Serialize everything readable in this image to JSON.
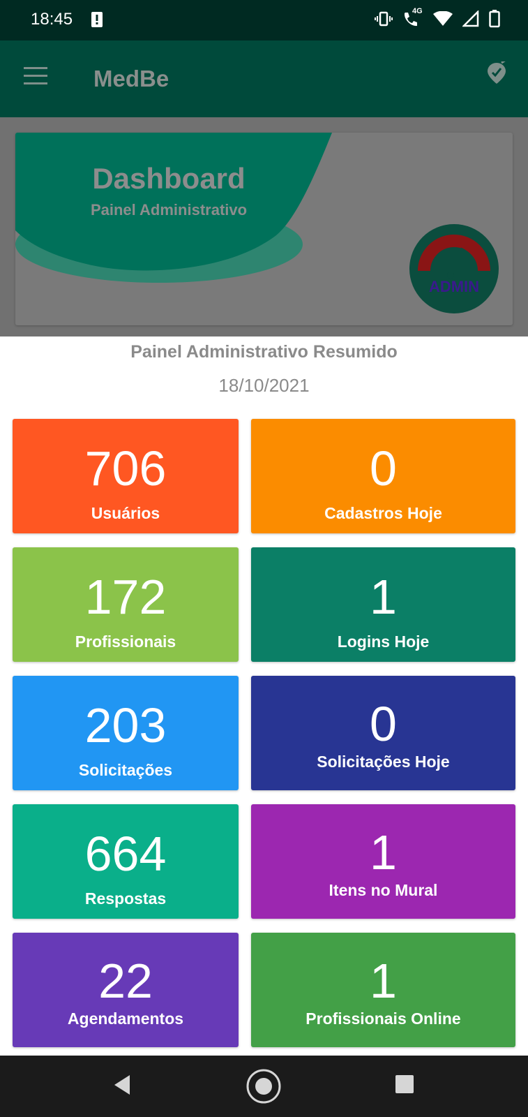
{
  "status_bar": {
    "time": "18:45",
    "icons": [
      "alert-icon",
      "vibrate-icon",
      "wifi-call-icon",
      "wifi-icon",
      "signal-icon",
      "battery-icon"
    ],
    "network_label": "4G"
  },
  "app_bar": {
    "title": "MedBe",
    "menu_icon": "menu-icon",
    "action_icon": "tag-icon"
  },
  "banner": {
    "title": "Dashboard",
    "subtitle": "Painel Administrativo",
    "badge_text": "ADMIN"
  },
  "summary": {
    "title": "Painel Administrativo Resumido",
    "date": "18/10/2021"
  },
  "tiles": [
    {
      "value": "706",
      "label": "Usuários",
      "color": "#ff5722"
    },
    {
      "value": "0",
      "label": "Cadastros Hoje",
      "color": "#fb8c00"
    },
    {
      "value": "172",
      "label": "Profissionais",
      "color": "#8bc34a"
    },
    {
      "value": "1",
      "label": "Logins Hoje",
      "color": "#0b7f66"
    },
    {
      "value": "203",
      "label": "Solicitações",
      "color": "#2196f3"
    },
    {
      "value": "0",
      "label": "Solicitações Hoje",
      "color": "#283593"
    },
    {
      "value": "664",
      "label": "Respostas",
      "color": "#0aaf8a"
    },
    {
      "value": "1",
      "label": "Itens no Mural",
      "color": "#9c27b0"
    },
    {
      "value": "22",
      "label": "Agendamentos",
      "color": "#673ab7"
    },
    {
      "value": "1",
      "label": "Profissionais Online",
      "color": "#43a047"
    }
  ],
  "nav_bar": {
    "icons": [
      "back-icon",
      "home-icon",
      "recents-icon"
    ]
  }
}
